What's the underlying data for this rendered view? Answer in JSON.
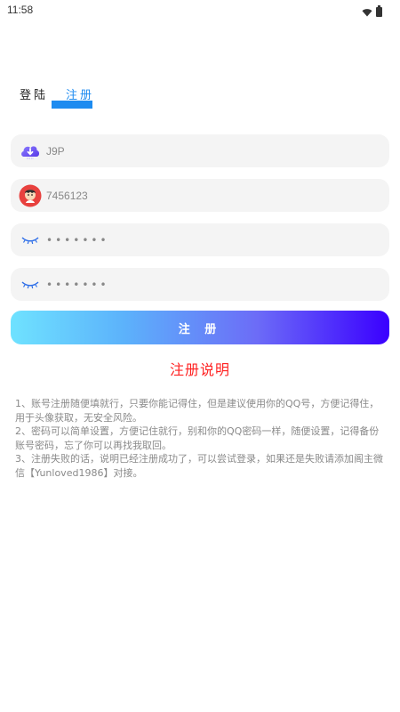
{
  "status_bar": {
    "time": "11:58"
  },
  "tabs": [
    {
      "label": "登陆"
    },
    {
      "label": "注册"
    }
  ],
  "active_tab_color": "#1d8bf0",
  "fields": {
    "username": "J9P",
    "qq": "7456123",
    "password": "•••••••",
    "confirm_password": "•••••••"
  },
  "register_button": {
    "label": "注 册"
  },
  "instructions": {
    "title": "注册说明",
    "items": [
      "1、账号注册随便填就行，只要你能记得住，但是建议使用你的QQ号，方便记得住，用于头像获取，无安全风险。",
      "2、密码可以简单设置，方便记住就行，别和你的QQ密码一样，随便设置，记得备份账号密码，忘了你可以再找我取回。",
      "3、注册失败的话，说明已经注册成功了，可以尝试登录，如果还是失败请添加阁主微信【Yunloved1986】对接。"
    ]
  },
  "colors": {
    "accent": "#1d8bf0",
    "title_red": "#ff2222",
    "button_gradient_start": "#6fe2ff",
    "button_gradient_end": "#3a00ff"
  }
}
